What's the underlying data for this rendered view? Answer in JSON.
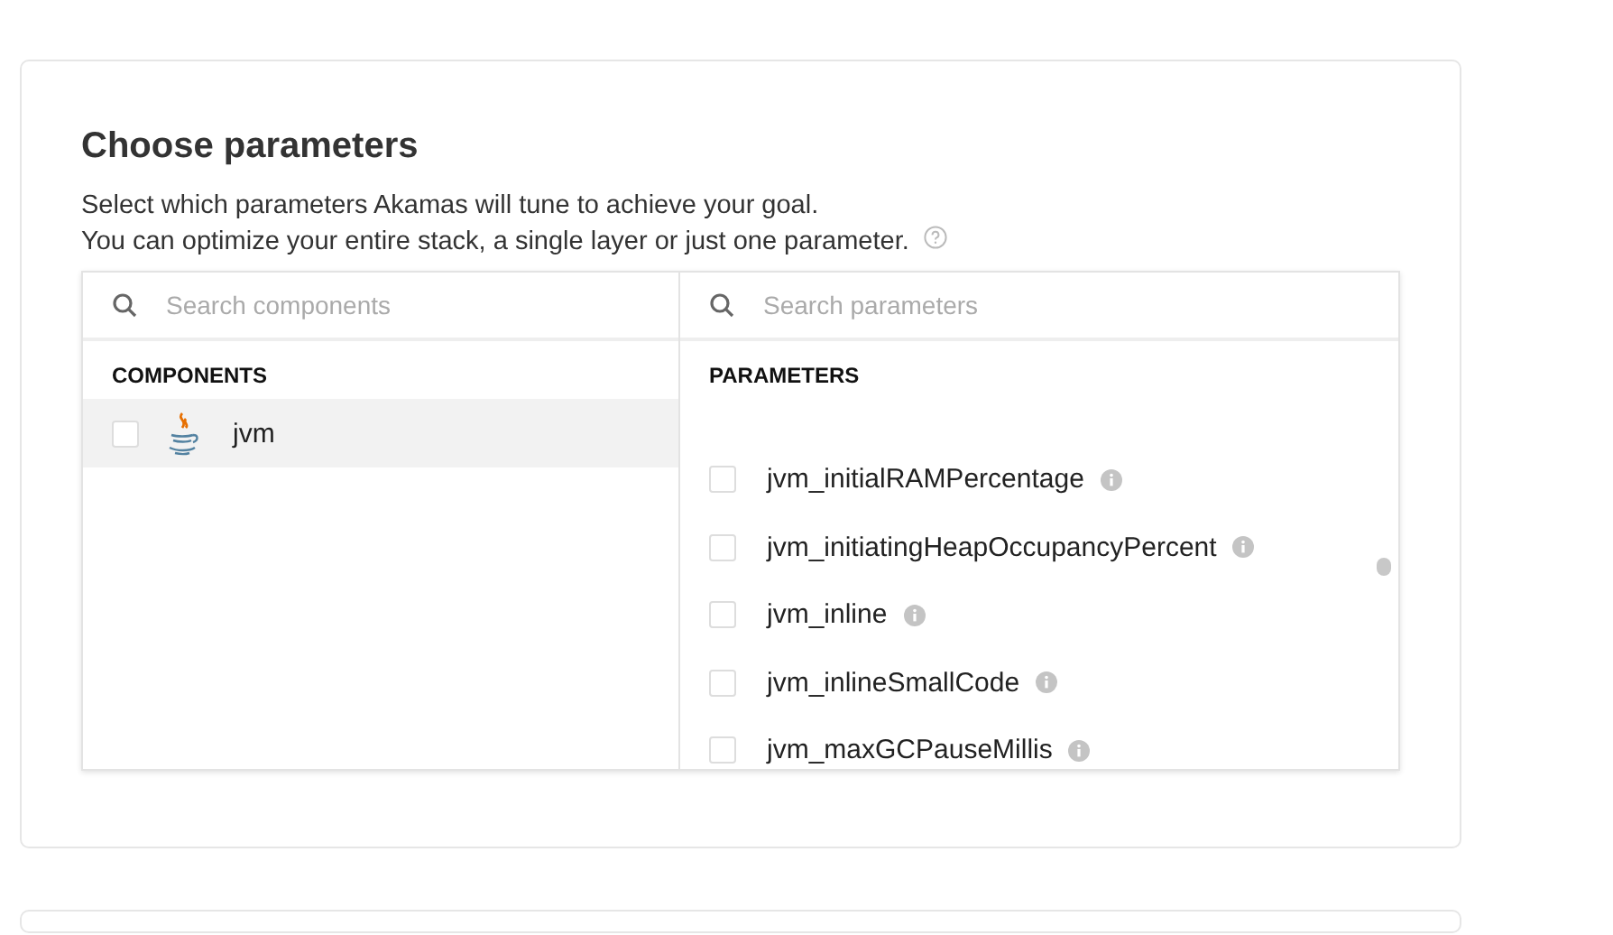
{
  "title": "Choose parameters",
  "description": [
    "Select which parameters Akamas will tune to achieve your goal.",
    "You can optimize your entire stack, a single layer or just one parameter."
  ],
  "components": {
    "search": {
      "placeholder": "Search components"
    },
    "heading": "COMPONENTS",
    "items": [
      {
        "name": "jvm",
        "selected": true,
        "checked": false
      }
    ]
  },
  "parameters": {
    "search": {
      "placeholder": "Search parameters"
    },
    "heading": "PARAMETERS",
    "items": [
      {
        "name": "jvm_initialRAMPercentage",
        "checked": false
      },
      {
        "name": "jvm_initiatingHeapOccupancyPercent",
        "checked": false
      },
      {
        "name": "jvm_inline",
        "checked": false
      },
      {
        "name": "jvm_inlineSmallCode",
        "checked": false
      },
      {
        "name": "jvm_maxGCPauseMillis",
        "checked": false
      }
    ]
  }
}
